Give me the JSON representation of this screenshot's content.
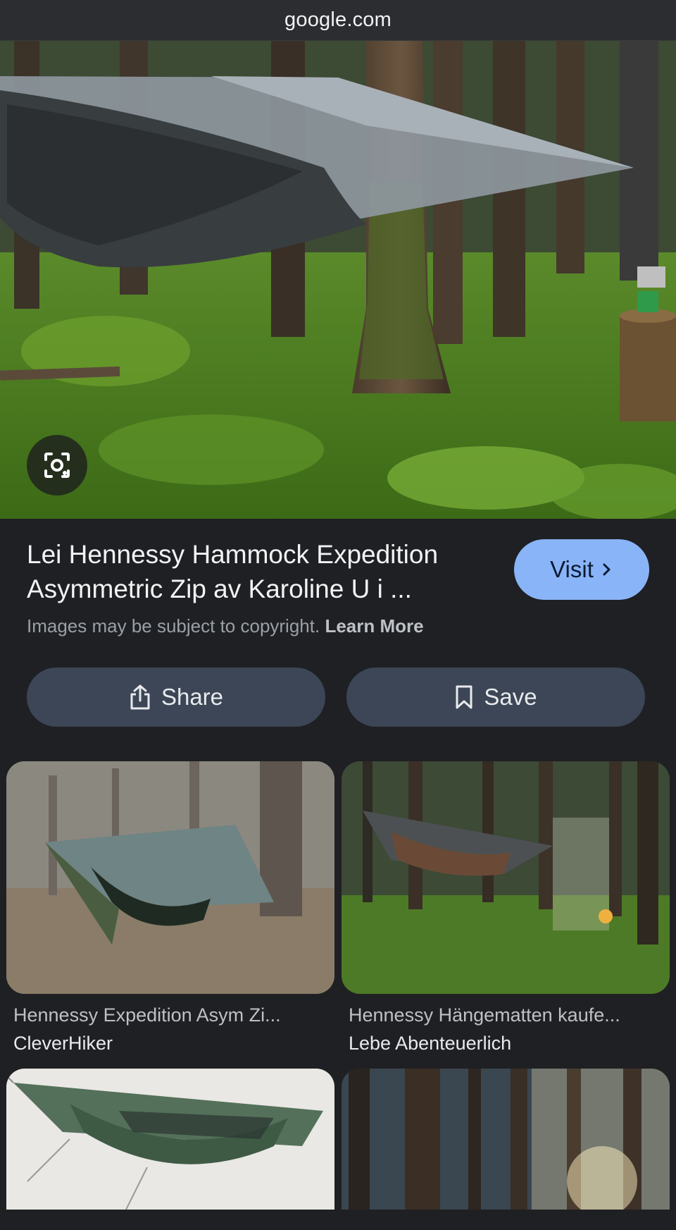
{
  "browser": {
    "domain": "google.com"
  },
  "preview": {
    "title": "Lei Hennessy Hammock Expedition Asymmetric Zip av Karoline U i ...",
    "visit_label": "Visit",
    "copyright_text": "Images may be subject to copyright.",
    "learn_more_label": "Learn More"
  },
  "actions": {
    "share_label": "Share",
    "save_label": "Save"
  },
  "related": [
    {
      "title": "Hennessy Expedition Asym Zi...",
      "source": "CleverHiker"
    },
    {
      "title": "Hennessy Hängematten kaufe...",
      "source": "Lebe Abenteuerlich"
    },
    {
      "title": "",
      "source": ""
    },
    {
      "title": "",
      "source": ""
    }
  ],
  "icons": {
    "lens": "google-lens-icon",
    "visit_chevron": "chevron-right-icon",
    "share": "share-icon",
    "save": "bookmark-icon"
  },
  "colors": {
    "visit_button": "#8ab4f8",
    "action_button": "#3c4656",
    "background": "#1f2023"
  }
}
